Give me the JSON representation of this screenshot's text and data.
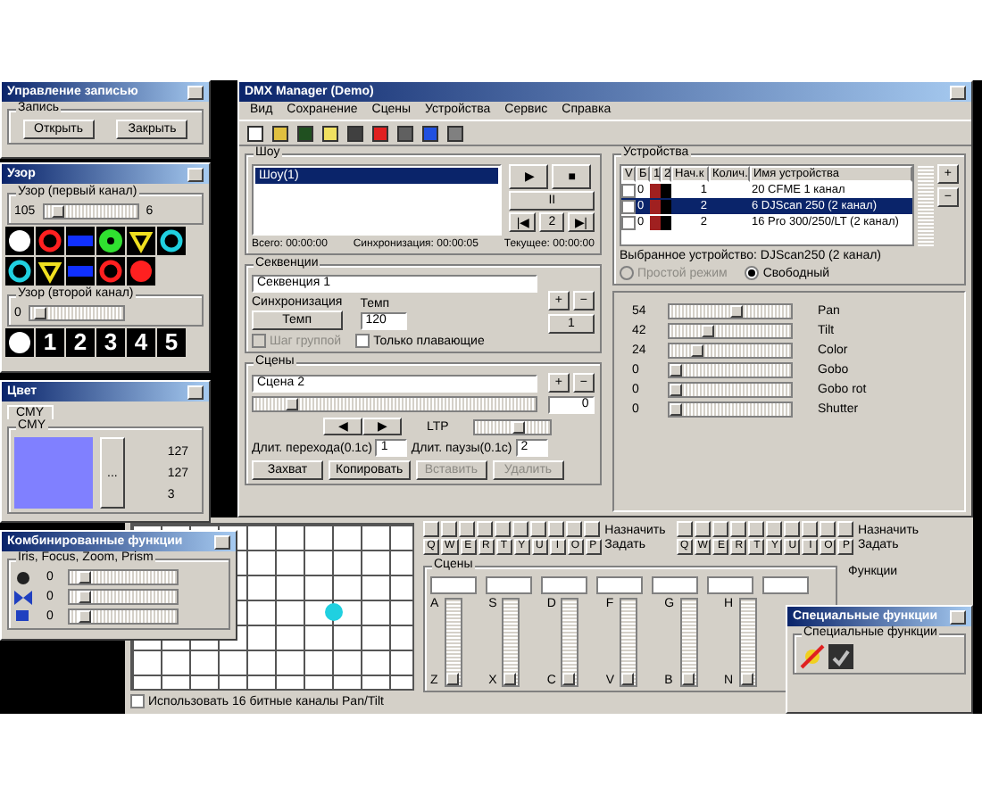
{
  "record_window": {
    "title": "Управление записью",
    "group": "Запись",
    "buttons": [
      "Открыть",
      "Закрыть"
    ]
  },
  "gobo_window": {
    "title": "Узор",
    "groups": [
      {
        "label": "Узор (первый канал)",
        "value": "105",
        "reading": "6",
        "level": 0.1,
        "gobos": [
          {
            "kind": "dot",
            "color": "#ffffff"
          },
          {
            "kind": "ring",
            "color": "#ff2020"
          },
          {
            "kind": "bar",
            "color": "#1030ff"
          },
          {
            "kind": "flower",
            "color": "#30e030"
          },
          {
            "kind": "triangle",
            "color": "#f0e020"
          },
          {
            "kind": "ring",
            "color": "#20d0e0"
          },
          {
            "kind": "ring",
            "color": "#20d0e0"
          },
          {
            "kind": "triangle",
            "color": "#f0e020"
          },
          {
            "kind": "bar",
            "color": "#1030ff"
          },
          {
            "kind": "ring",
            "color": "#ff2020"
          },
          {
            "kind": "dot",
            "color": "#ff2020"
          }
        ]
      },
      {
        "label": "Узор (второй канал)",
        "value": "0",
        "level": 0.05,
        "gobos": [
          {
            "kind": "dot",
            "color": "#ffffff"
          },
          {
            "kind": "digit",
            "label": "1"
          },
          {
            "kind": "digit",
            "label": "2"
          },
          {
            "kind": "digit",
            "label": "3"
          },
          {
            "kind": "digit",
            "label": "4"
          },
          {
            "kind": "digit",
            "label": "5"
          }
        ]
      }
    ]
  },
  "color_window": {
    "title": "Цвет",
    "tabs": [
      {
        "label": "CMY",
        "selected": true
      }
    ],
    "group": "CMY",
    "swatch": {
      "color": "#8080ff"
    },
    "button": "...",
    "values": [
      "127",
      "127",
      "3"
    ]
  },
  "main_window": {
    "title": "DMX Manager (Demo)",
    "menu": [
      "Вид",
      "Сохранение",
      "Сцены",
      "Устройства",
      "Сервис",
      "Справка"
    ],
    "shows": {
      "label": "Шоу",
      "items": [
        {
          "label": "Шоу(1)",
          "selected": true
        }
      ],
      "controls": [
        "▶",
        "■",
        "II",
        "|◀",
        "2",
        "▶|"
      ],
      "times": [
        "Всего: 00:00:00",
        "Синхронизация: 00:00:05",
        "Текущее: 00:00:00"
      ]
    },
    "sequences": {
      "label": "Секвенции",
      "value": "Секвенция 1",
      "sync_label": "Синхронизация",
      "sync_button": "Темп",
      "tempo_label": "Темп",
      "tempo": "120",
      "checks": [
        {
          "label": "Шаг группой",
          "checked": false,
          "disabled": true
        },
        {
          "label": "Только плавающие",
          "checked": false,
          "disabled": false
        }
      ],
      "buttons": [
        "+",
        "−",
        "1"
      ]
    },
    "scenes": {
      "label": "Сцены",
      "value": "Сцена 2",
      "level": 0.12,
      "buttons": [
        "+",
        "−",
        "0"
      ],
      "nav": [
        "◀",
        "▶"
      ],
      "ltp": {
        "label": "LTP",
        "level": 0.6
      },
      "fade_label": "Длит. перехода(0.1с)",
      "fade": "1",
      "pause_label": "Длит. паузы(0.1с)",
      "pause": "2",
      "actions": [
        {
          "label": "Захват",
          "disabled": false
        },
        {
          "label": "Копировать",
          "disabled": false
        },
        {
          "label": "Вставить",
          "disabled": true
        },
        {
          "label": "Удалить",
          "disabled": true
        }
      ]
    },
    "devices": {
      "label": "Устройства",
      "columns": [
        "V",
        "Б",
        "1",
        "2",
        "Нач.к",
        "Колич.",
        "Имя устройства"
      ],
      "rows": [
        {
          "checked": false,
          "b": "0",
          "start": "1",
          "name": "20 CFME 1 канал",
          "selected": false
        },
        {
          "checked": false,
          "b": "0",
          "start": "2",
          "name": "6 DJScan 250 (2 канал)",
          "selected": true
        },
        {
          "checked": false,
          "b": "0",
          "start": "2",
          "name": "16 Pro 300/250/LT (2 канал)",
          "selected": false
        }
      ],
      "buttons": [
        "+",
        "−"
      ],
      "selected_label": "Выбранное устройство: DJScan250 (2 канал)",
      "modes": [
        {
          "label": "Простой режим",
          "selected": false,
          "disabled": true
        },
        {
          "label": "Свободный",
          "selected": true,
          "disabled": false
        }
      ]
    },
    "channels": [
      {
        "value": "54",
        "level": 0.55,
        "name": "Pan"
      },
      {
        "value": "42",
        "level": 0.3,
        "name": "Tilt"
      },
      {
        "value": "24",
        "level": 0.2,
        "name": "Color"
      },
      {
        "value": "0",
        "level": 0,
        "name": "Gobo"
      },
      {
        "value": "0",
        "level": 0,
        "name": "Gobo rot"
      },
      {
        "value": "0",
        "level": 0,
        "name": "Shutter"
      }
    ]
  },
  "combo_window": {
    "title": "Комбинированные функции",
    "group": "Iris, Focus, Zoom, Prism",
    "rows": [
      {
        "value": "0",
        "level": 0.1
      },
      {
        "value": "0",
        "level": 0.1
      },
      {
        "value": "0",
        "level": 0.1
      }
    ]
  },
  "pan_tilt": {
    "check": {
      "label": "Использовать 16 битные каналы Pan/Tilt",
      "checked": false
    }
  },
  "keyboard": {
    "key_groups": [
      {
        "caption": "Назначить",
        "keys": [
          "Q",
          "W",
          "E",
          "R",
          "T",
          "Y",
          "U",
          "I",
          "O",
          "P"
        ],
        "button": "Задать"
      },
      {
        "caption": "Назначить",
        "keys": [
          "Q",
          "W",
          "E",
          "R",
          "T",
          "Y",
          "U",
          "I",
          "O",
          "P"
        ],
        "button": "Задать"
      }
    ],
    "faders_label": "Сцены",
    "functions_label": "Функции",
    "faders": [
      {
        "up": "A",
        "down": "Z",
        "level": 0
      },
      {
        "up": "S",
        "down": "X",
        "level": 0
      },
      {
        "up": "D",
        "down": "C",
        "level": 0
      },
      {
        "up": "F",
        "down": "V",
        "level": 0
      },
      {
        "up": "G",
        "down": "B",
        "level": 0
      },
      {
        "up": "H",
        "down": "N",
        "level": 0
      }
    ]
  },
  "special_window": {
    "title": "Специальные функции",
    "group": "Специальные функции"
  }
}
